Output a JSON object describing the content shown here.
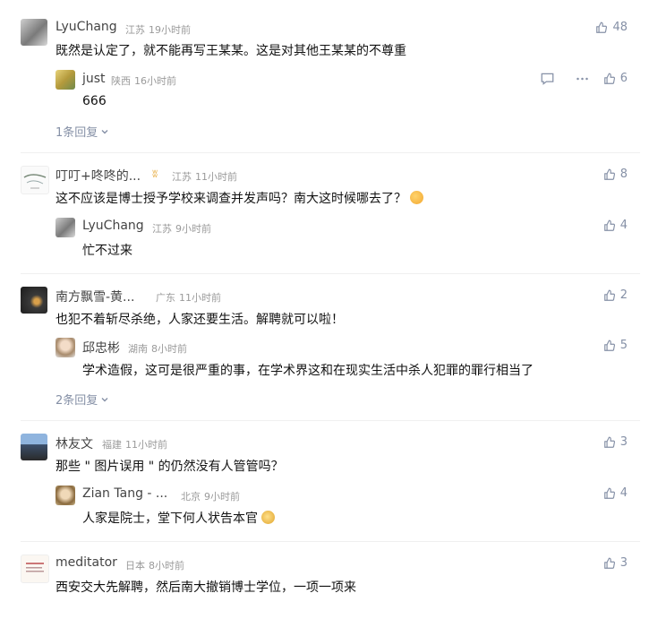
{
  "comments": [
    {
      "author": "LyuChang",
      "location": "江苏",
      "time": "19小时前",
      "text": "既然是认定了，就不能再写王某某。这是对其他王某某的不尊重",
      "likes": "48",
      "replies": [
        {
          "author": "just",
          "location": "陕西",
          "time": "16小时前",
          "text": "666",
          "likes": "6"
        }
      ],
      "more_replies": "1条回复"
    },
    {
      "author": "叮叮+咚咚的...",
      "location": "江苏",
      "time": "11小时前",
      "text": "这不应该是博士授予学校来调查并发声吗？南大这时候哪去了？",
      "likes": "8",
      "replies": [
        {
          "author": "LyuChang",
          "location": "江苏",
          "time": "9小时前",
          "text": "忙不过来",
          "likes": "4"
        }
      ]
    },
    {
      "author": "南方飘雪-黄...",
      "location": "广东",
      "time": "11小时前",
      "text": "也犯不着斩尽杀绝，人家还要生活。解聘就可以啦！",
      "likes": "2",
      "replies": [
        {
          "author": "邱忠彬",
          "location": "湖南",
          "time": "8小时前",
          "text": "学术造假，这可是很严重的事，在学术界这和在现实生活中杀人犯罪的罪行相当了",
          "likes": "5"
        }
      ],
      "more_replies": "2条回复"
    },
    {
      "author": "林友文",
      "location": "福建",
      "time": "11小时前",
      "text": "那些 \" 图片误用 \" 的仍然没有人管管吗？",
      "likes": "3",
      "replies": [
        {
          "author": "Zian Tang - ...",
          "location": "北京",
          "time": "9小时前",
          "text": "人家是院士，堂下何人状告本官",
          "likes": "4"
        }
      ]
    },
    {
      "author": "meditator",
      "location": "日本",
      "time": "8小时前",
      "text": "西安交大先解聘，然后南大撤销博士学位，一项一项来",
      "likes": "3"
    }
  ],
  "icons": {
    "like": "thumbs-up-icon",
    "reply": "comment-icon",
    "more": "more-dots-icon",
    "expand": "chevron-down-icon"
  },
  "colors": {
    "name": "#444444",
    "meta": "#9a9a9a",
    "action": "#8590a6",
    "text": "#121212"
  }
}
